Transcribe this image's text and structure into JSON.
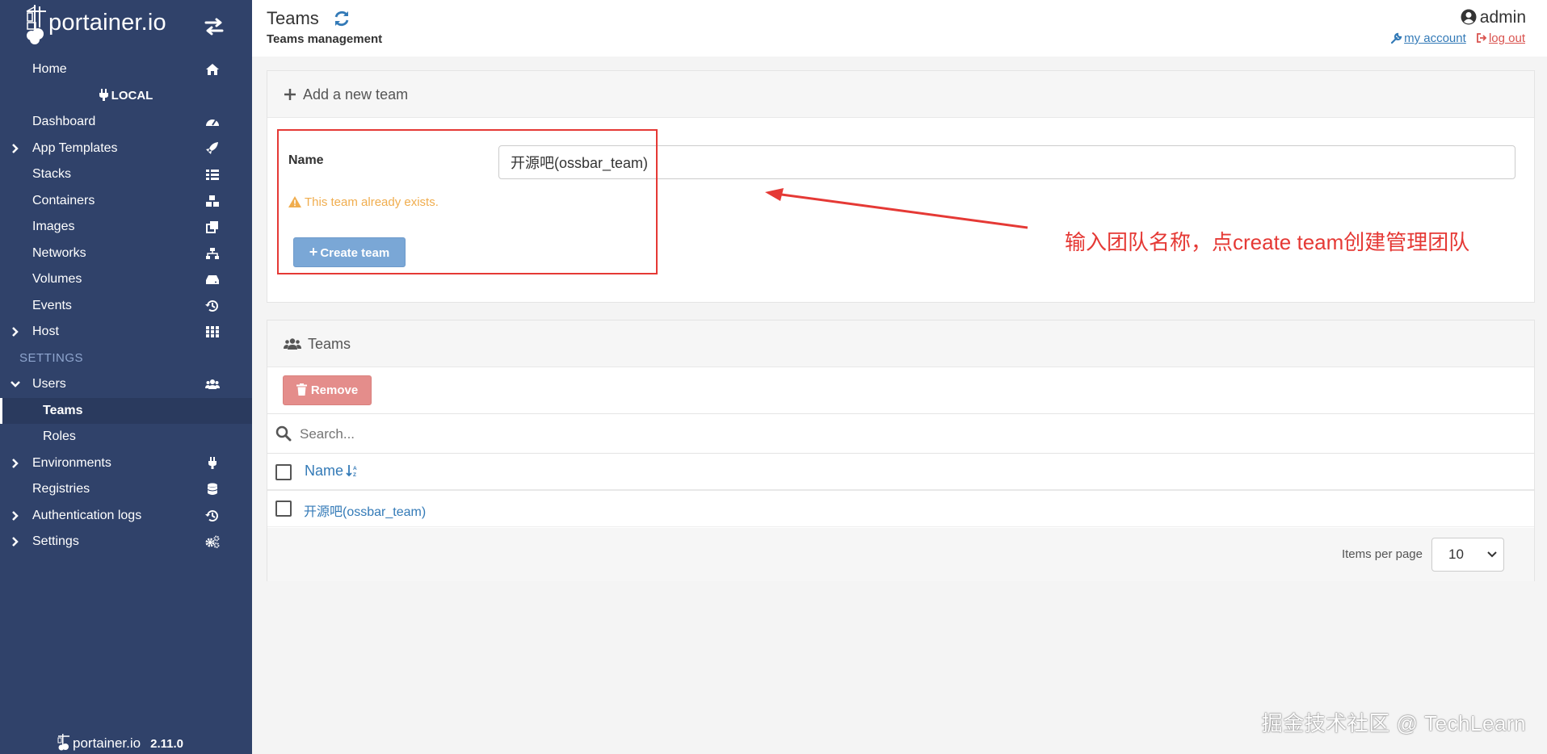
{
  "app": {
    "name": "portainer.io",
    "version": "2.11.0"
  },
  "sidebar": {
    "items": [
      {
        "label": "Home",
        "icon": "home-icon"
      },
      {
        "label": "LOCAL",
        "icon": "plug-icon"
      },
      {
        "label": "Dashboard",
        "icon": "dashboard-icon"
      },
      {
        "label": "App Templates",
        "icon": "rocket-icon"
      },
      {
        "label": "Stacks",
        "icon": "list-icon"
      },
      {
        "label": "Containers",
        "icon": "cubes-icon"
      },
      {
        "label": "Images",
        "icon": "clone-icon"
      },
      {
        "label": "Networks",
        "icon": "sitemap-icon"
      },
      {
        "label": "Volumes",
        "icon": "hdd-icon"
      },
      {
        "label": "Events",
        "icon": "history-icon"
      },
      {
        "label": "Host",
        "icon": "th-icon"
      },
      {
        "label": "SETTINGS"
      },
      {
        "label": "Users",
        "icon": "users-icon"
      },
      {
        "label": "Teams"
      },
      {
        "label": "Roles"
      },
      {
        "label": "Environments",
        "icon": "plug-icon"
      },
      {
        "label": "Registries",
        "icon": "database-icon"
      },
      {
        "label": "Authentication logs",
        "icon": "history-icon"
      },
      {
        "label": "Settings",
        "icon": "cogs-icon"
      }
    ]
  },
  "header": {
    "title": "Teams",
    "subtitle": "Teams management",
    "user": "admin",
    "my_account": "my account",
    "logout": "log out"
  },
  "new_team": {
    "heading": "Add a new team",
    "name_label": "Name",
    "name_value": "开源吧(ossbar_team)",
    "warning": "This team already exists.",
    "create_label": "Create team"
  },
  "teams": {
    "heading": "Teams",
    "remove_label": "Remove",
    "search_placeholder": "Search...",
    "column_name": "Name",
    "rows": [
      {
        "name": "开源吧(ossbar_team)"
      }
    ],
    "items_per_page_label": "Items per page",
    "items_per_page_value": "10"
  },
  "annotation": {
    "text": "输入团队名称，点create team创建管理团队"
  },
  "watermark": "掘金技术社区 @ TechLearn",
  "colors": {
    "sidebar": "#30426a",
    "link": "#337ab7",
    "warning": "#f0ad4e",
    "annotation": "#e53935",
    "remove": "#e48d8b",
    "create": "#7aa7d6"
  }
}
